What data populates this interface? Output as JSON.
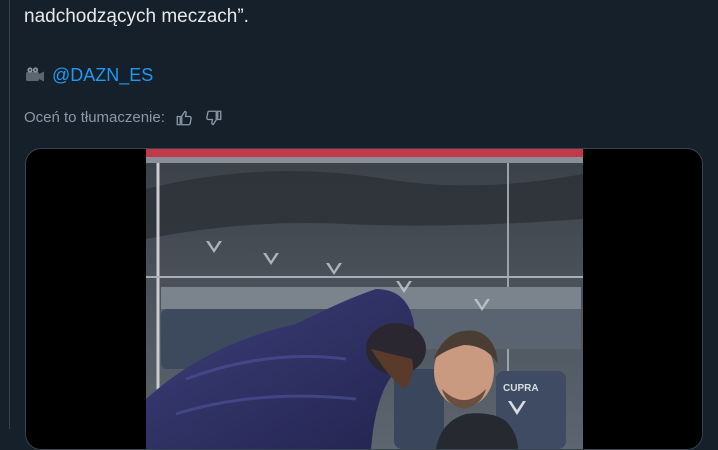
{
  "tweet": {
    "text_line": "nadchodzących meczach”.",
    "source_mention": "@DAZN_ES"
  },
  "translation_rating": {
    "label": "Oceń to tłumaczenie:"
  },
  "media": {
    "seat_brand": "CUPRA"
  },
  "icons": [
    "camera-icon",
    "thumbs-up-icon",
    "thumbs-down-icon"
  ],
  "colors": {
    "background": "#15202b",
    "text": "#e7e9ea",
    "muted": "#8b98a5",
    "link": "#1d9bf0",
    "border": "#38444d"
  }
}
